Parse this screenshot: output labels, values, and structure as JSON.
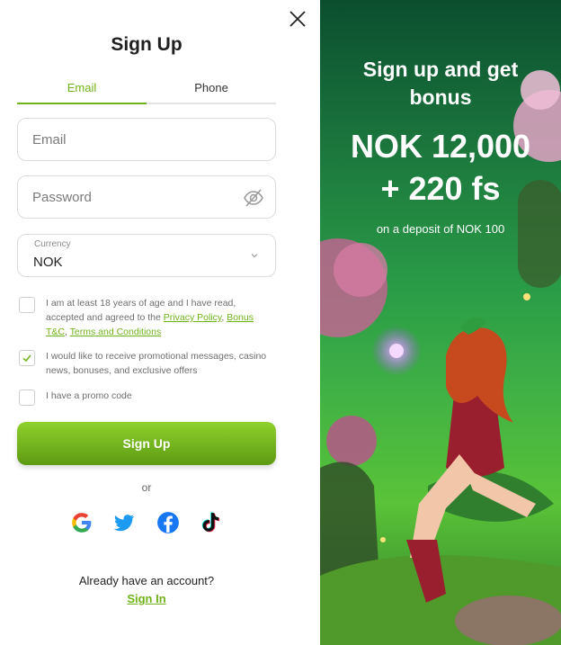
{
  "form": {
    "title": "Sign Up",
    "tabs": [
      {
        "label": "Email",
        "active": true
      },
      {
        "label": "Phone",
        "active": false
      }
    ],
    "email": {
      "placeholder": "Email",
      "value": ""
    },
    "password": {
      "placeholder": "Password",
      "value": ""
    },
    "currency": {
      "label": "Currency",
      "value": "NOK"
    },
    "checkboxes": {
      "terms": {
        "checked": false,
        "text_before": "I am at least 18 years of age and I have read, accepted and agreed to the ",
        "privacy_link": "Privacy Policy",
        "separator": ", ",
        "bonus_link": "Bonus T&C",
        "comma": ", ",
        "terms_link": "Terms and Conditions"
      },
      "promo_messages": {
        "checked": true,
        "text": "I would like to receive promotional messages, casino news, bonuses, and exclusive offers"
      },
      "promo_code": {
        "checked": false,
        "text": "I have a promo code"
      }
    },
    "submit_label": "Sign Up",
    "or_label": "or",
    "social": [
      {
        "name": "google-icon"
      },
      {
        "name": "twitter-icon"
      },
      {
        "name": "facebook-icon"
      },
      {
        "name": "tiktok-icon"
      }
    ],
    "already_text": "Already have an account?",
    "signin_label": "Sign In"
  },
  "promo": {
    "headline_1": "Sign up and get",
    "headline_2": "bonus",
    "amount": "NOK 12,000",
    "free_spins": "+ 220 fs",
    "subtext": "on a deposit of NOK 100"
  },
  "colors": {
    "accent": "#6fb319",
    "button_top": "#8fd12c",
    "button_bottom": "#5d9a12"
  }
}
